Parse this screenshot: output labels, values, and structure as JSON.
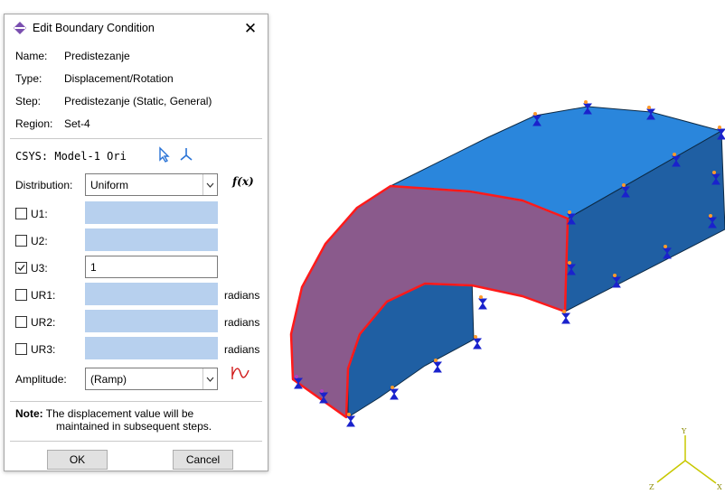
{
  "dialog": {
    "title": "Edit Boundary Condition",
    "close_glyph": "✕",
    "fields": {
      "name_label": "Name:",
      "name_value": "Predistezanje",
      "type_label": "Type:",
      "type_value": "Displacement/Rotation",
      "step_label": "Step:",
      "step_value": "Predistezanje (Static, General)",
      "region_label": "Region:",
      "region_value": "Set-4"
    },
    "csys": {
      "label": "CSYS:",
      "value": "Model-1 Ori"
    },
    "distribution": {
      "label": "Distribution:",
      "value": "Uniform",
      "fx_label": "f(x)"
    },
    "dofs": [
      {
        "label": "U1:",
        "checked": false,
        "value": "",
        "unit": ""
      },
      {
        "label": "U2:",
        "checked": false,
        "value": "",
        "unit": ""
      },
      {
        "label": "U3:",
        "checked": true,
        "value": "1",
        "unit": ""
      },
      {
        "label": "UR1:",
        "checked": false,
        "value": "",
        "unit": "radians"
      },
      {
        "label": "UR2:",
        "checked": false,
        "value": "",
        "unit": "radians"
      },
      {
        "label": "UR3:",
        "checked": false,
        "value": "",
        "unit": "radians"
      }
    ],
    "amplitude": {
      "label": "Amplitude:",
      "value": "(Ramp)"
    },
    "note": {
      "label": "Note:",
      "line1": "The displacement value will be",
      "line2": "maintained in subsequent steps."
    },
    "buttons": {
      "ok": "OK",
      "cancel": "Cancel"
    }
  },
  "viewport": {
    "triad": {
      "x": "X",
      "y": "Y",
      "z": "Z"
    },
    "colors": {
      "solid_top": "#2a86dc",
      "solid_side": "#1f5fa3",
      "selected_face": "#8a5a8c",
      "edge_highlight": "#ff1a1a",
      "triad": "#c8c800"
    }
  }
}
